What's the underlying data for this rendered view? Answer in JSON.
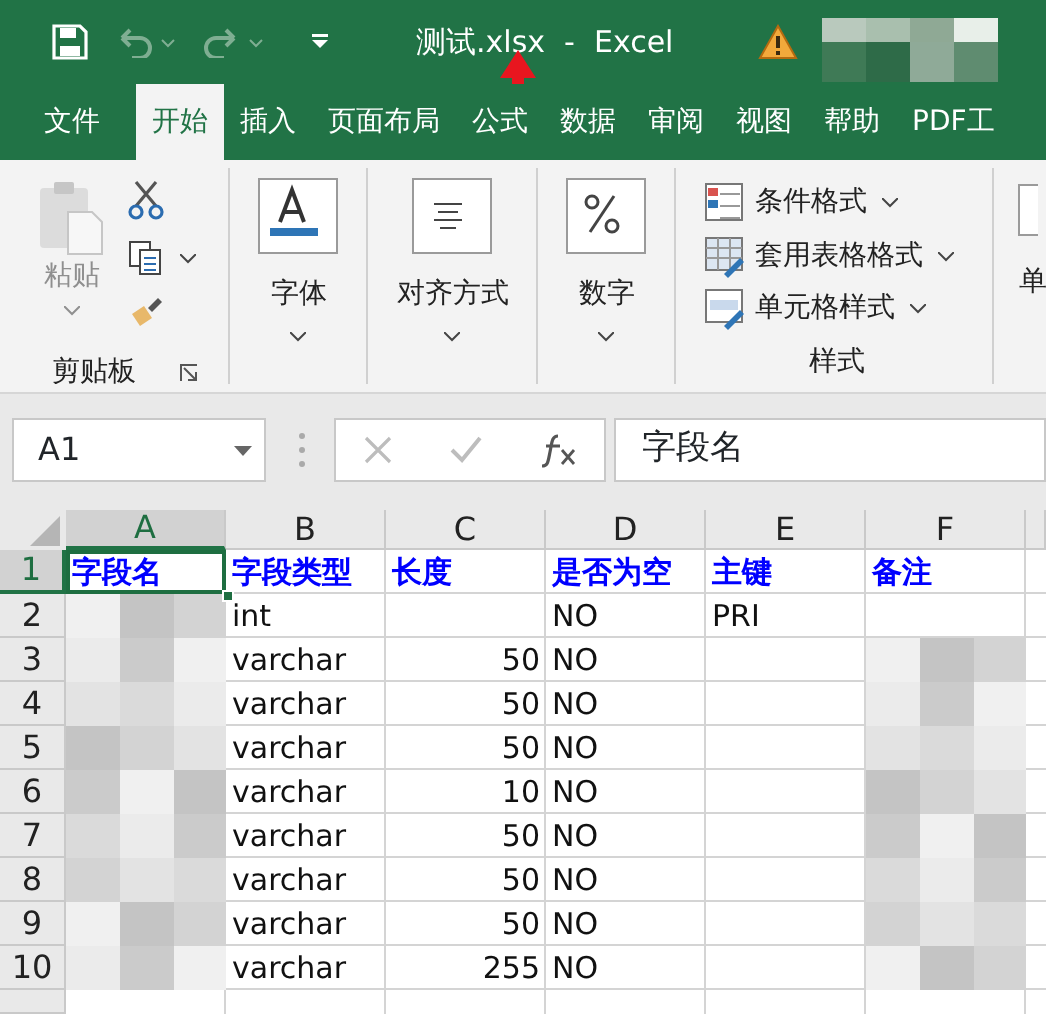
{
  "title_bar": {
    "title": "测试.xlsx  -  Excel",
    "warning": true
  },
  "ribbon_tabs": [
    {
      "label": "文件",
      "selected": false
    },
    {
      "label": "开始",
      "selected": true
    },
    {
      "label": "插入",
      "selected": false
    },
    {
      "label": "页面布局",
      "selected": false
    },
    {
      "label": "公式",
      "selected": false
    },
    {
      "label": "数据",
      "selected": false
    },
    {
      "label": "审阅",
      "selected": false
    },
    {
      "label": "视图",
      "selected": false
    },
    {
      "label": "帮助",
      "selected": false
    },
    {
      "label": "PDF工",
      "selected": false
    }
  ],
  "clipboard": {
    "label": "剪贴板",
    "paste_label": "粘贴",
    "paste_disabled": true
  },
  "big_buttons": [
    {
      "label": "字体",
      "kind": "font"
    },
    {
      "label": "对齐方式",
      "kind": "align"
    },
    {
      "label": "数字",
      "kind": "number"
    }
  ],
  "styles": {
    "label": "样式",
    "items": [
      {
        "label": "条件格式",
        "kind": "conditional"
      },
      {
        "label": "套用表格格式",
        "kind": "table"
      },
      {
        "label": "单元格样式",
        "kind": "cell"
      }
    ]
  },
  "cut_off_button": "单",
  "formula_bar": {
    "name_box": "A1",
    "formula": "字段名"
  },
  "sheet": {
    "columns": [
      {
        "label": "A",
        "selected": true
      },
      {
        "label": "B",
        "selected": false
      },
      {
        "label": "C",
        "selected": false
      },
      {
        "label": "D",
        "selected": false
      },
      {
        "label": "E",
        "selected": false
      },
      {
        "label": "F",
        "selected": false
      }
    ],
    "rows": [
      {
        "header": "1",
        "selected": true,
        "kind": "heading",
        "cells": [
          "字段名",
          "字段类型",
          "长度",
          "是否为空",
          "主键",
          "备注"
        ]
      },
      {
        "header": "2",
        "selected": false,
        "kind": "data",
        "cells": [
          {
            "kind": "pixelated"
          },
          "int",
          null,
          "NO",
          "PRI",
          null
        ]
      },
      {
        "header": "3",
        "selected": false,
        "kind": "data",
        "cells": [
          {
            "kind": "pixelated"
          },
          "varchar",
          {
            "kind": "number",
            "text": "50"
          },
          "NO",
          null,
          {
            "kind": "pixelated"
          }
        ]
      },
      {
        "header": "4",
        "selected": false,
        "kind": "data",
        "cells": [
          {
            "kind": "pixelated"
          },
          "varchar",
          {
            "kind": "number",
            "text": "50"
          },
          "NO",
          null,
          {
            "kind": "pixelated"
          }
        ]
      },
      {
        "header": "5",
        "selected": false,
        "kind": "data",
        "cells": [
          {
            "kind": "pixelated"
          },
          "varchar",
          {
            "kind": "number",
            "text": "50"
          },
          "NO",
          null,
          {
            "kind": "pixelated"
          }
        ]
      },
      {
        "header": "6",
        "selected": false,
        "kind": "data",
        "cells": [
          {
            "kind": "pixelated"
          },
          "varchar",
          {
            "kind": "number",
            "text": "10"
          },
          "NO",
          null,
          {
            "kind": "pixelated"
          }
        ]
      },
      {
        "header": "7",
        "selected": false,
        "kind": "data",
        "cells": [
          {
            "kind": "pixelated"
          },
          "varchar",
          {
            "kind": "number",
            "text": "50"
          },
          "NO",
          null,
          {
            "kind": "pixelated"
          }
        ]
      },
      {
        "header": "8",
        "selected": false,
        "kind": "data",
        "cells": [
          {
            "kind": "pixelated"
          },
          "varchar",
          {
            "kind": "number",
            "text": "50"
          },
          "NO",
          null,
          {
            "kind": "pixelated"
          }
        ]
      },
      {
        "header": "9",
        "selected": false,
        "kind": "data",
        "cells": [
          {
            "kind": "pixelated"
          },
          "varchar",
          {
            "kind": "number",
            "text": "50"
          },
          "NO",
          null,
          {
            "kind": "pixelated"
          }
        ]
      },
      {
        "header": "10",
        "selected": false,
        "kind": "data",
        "cells": [
          {
            "kind": "pixelated"
          },
          "varchar",
          {
            "kind": "number",
            "text": "255"
          },
          "NO",
          null,
          {
            "kind": "pixelated"
          }
        ]
      }
    ]
  }
}
